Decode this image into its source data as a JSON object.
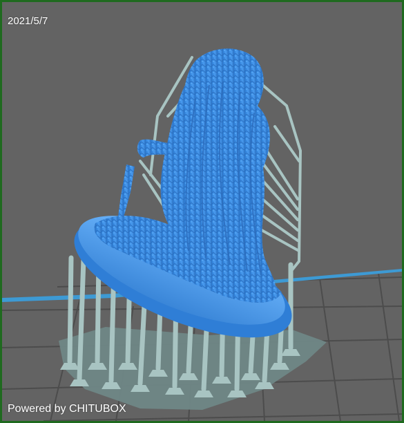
{
  "viewer": {
    "date_stamp": "2021/5/7",
    "watermark": "Powered by CHITUBOX"
  },
  "colors": {
    "frame_border": "#1f6a1f",
    "background": "#636363",
    "grid_line": "#4f4f4f",
    "build_plate_edge": "#3d9ad4",
    "model_blue": "#3f8fe6",
    "support_color": "#a8c4c2",
    "raft_color": "#6f8786"
  },
  "icons": [
    "3d-model-view"
  ]
}
